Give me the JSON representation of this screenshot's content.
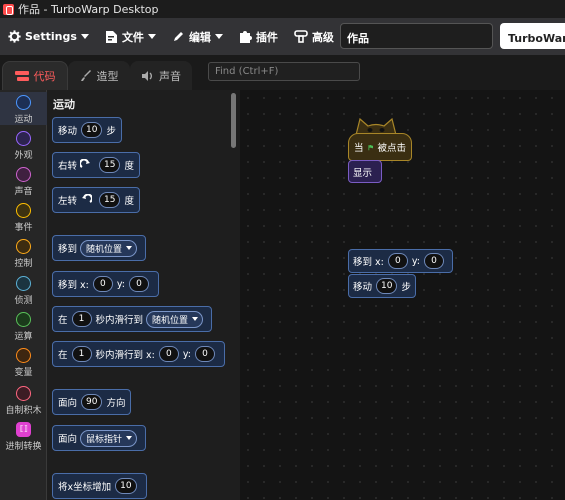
{
  "window": {
    "title": "作品 - TurboWarp Desktop"
  },
  "menubar": {
    "settings": "Settings",
    "file": "文件",
    "edit": "编辑",
    "addons": "插件",
    "advanced": "高级",
    "project_title": "作品",
    "feedback": "TurboWarp反馈"
  },
  "tabs": {
    "code": "代码",
    "costumes": "造型",
    "sounds": "声音"
  },
  "find": {
    "placeholder": "Find (Ctrl+F)"
  },
  "categories": [
    {
      "label": "运动",
      "color": "#4c97ff",
      "fill": "#1d2f55"
    },
    {
      "label": "外观",
      "color": "#9966ff",
      "fill": "#2d2450"
    },
    {
      "label": "声音",
      "color": "#cf63cf",
      "fill": "#3f2040"
    },
    {
      "label": "事件",
      "color": "#ffbf00",
      "fill": "#3d3210"
    },
    {
      "label": "控制",
      "color": "#ffab19",
      "fill": "#3d2c10"
    },
    {
      "label": "侦测",
      "color": "#5cb1d6",
      "fill": "#1b3440"
    },
    {
      "label": "运算",
      "color": "#59c059",
      "fill": "#1b3a1b"
    },
    {
      "label": "变量",
      "color": "#ff8c1a",
      "fill": "#3d2610"
    },
    {
      "label": "自制积木",
      "color": "#ff6680",
      "fill": "#3d1c24"
    },
    {
      "label": "进制转换",
      "color": "#e040d0",
      "fill": "#e040d0"
    }
  ],
  "palette": {
    "heading": "运动",
    "move": {
      "a": "移动",
      "n": "10",
      "b": "步"
    },
    "turn_right": {
      "a": "右转",
      "n": "15",
      "b": "度"
    },
    "turn_left": {
      "a": "左转",
      "n": "15",
      "b": "度"
    },
    "goto": {
      "a": "移到",
      "menu": "随机位置"
    },
    "goto_xy": {
      "a": "移到 x:",
      "x": "0",
      "yl": "y:",
      "y": "0"
    },
    "glide": {
      "a": "在",
      "n": "1",
      "b": "秒内滑行到",
      "menu": "随机位置"
    },
    "glide_xy": {
      "a": "在",
      "n": "1",
      "b": "秒内滑行到 x:",
      "x": "0",
      "yl": "y:",
      "y": "0"
    },
    "point": {
      "a": "面向",
      "n": "90",
      "b": "方向"
    },
    "point_towards": {
      "a": "面向",
      "menu": "鼠标指针"
    },
    "change_x": {
      "a": "将x坐标增加",
      "n": "10"
    }
  },
  "workspace": {
    "hat": {
      "a": "当",
      "b": "被点击"
    },
    "show": "显示",
    "goto_xy": {
      "a": "移到 x:",
      "x": "0",
      "yl": "y:",
      "y": "0"
    },
    "move": {
      "a": "移动",
      "n": "10",
      "b": "步"
    }
  }
}
